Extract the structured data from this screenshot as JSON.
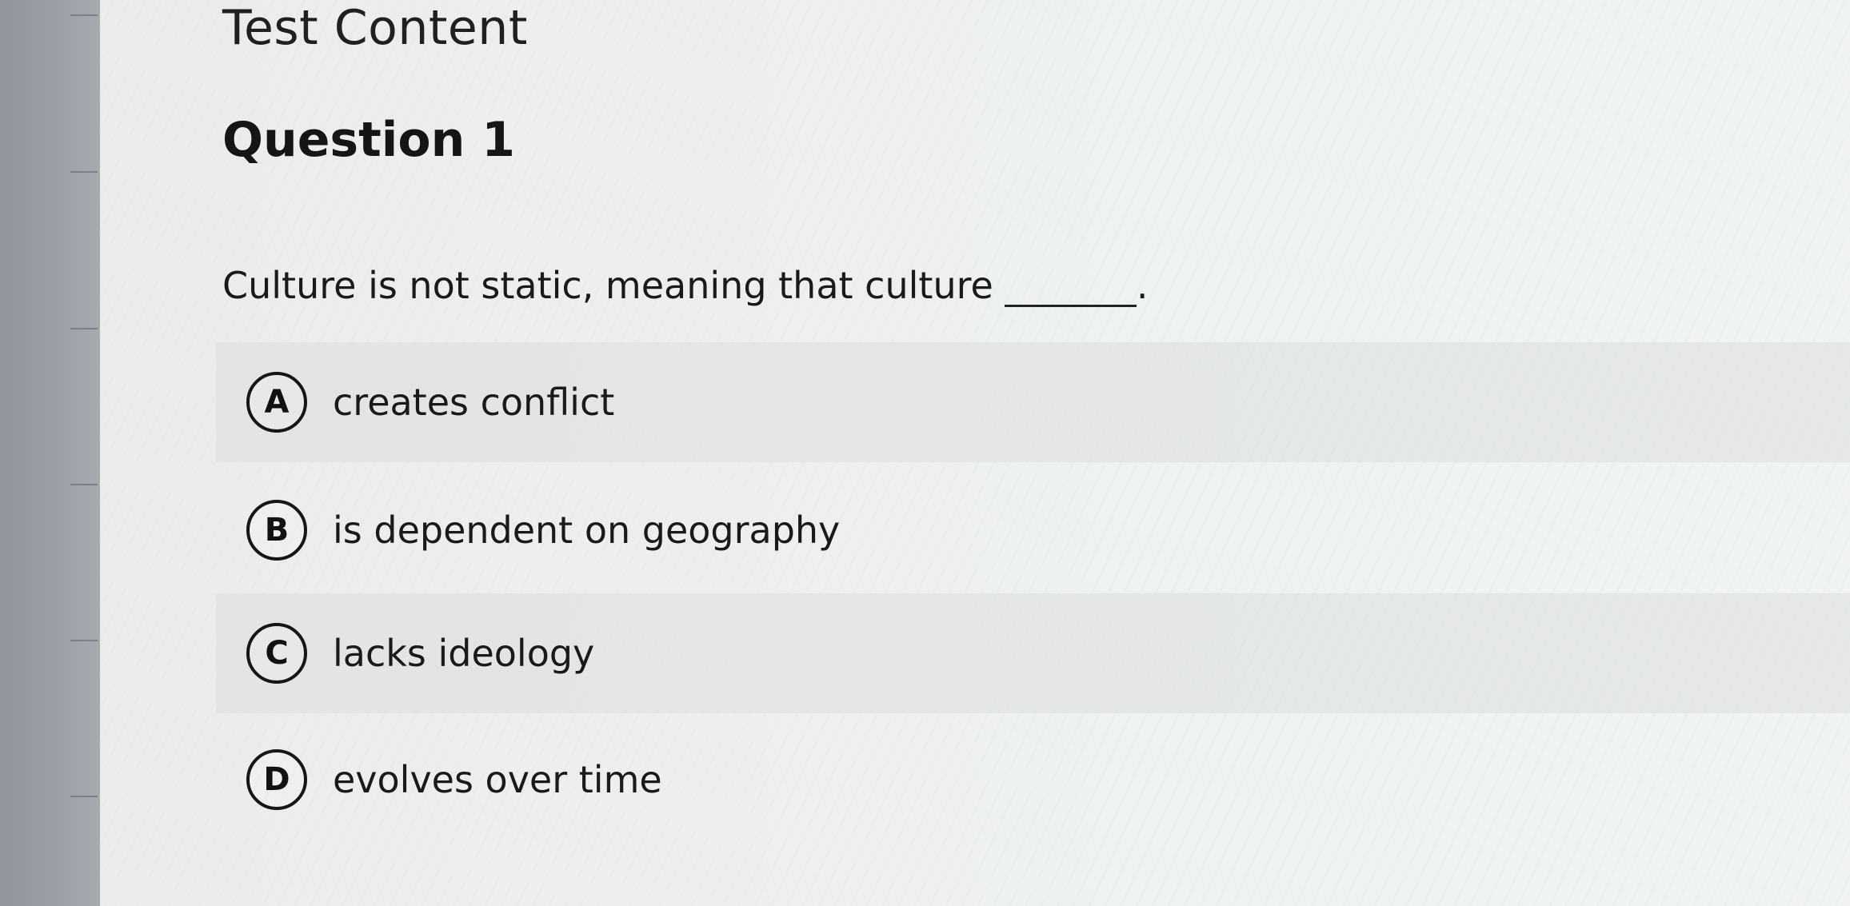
{
  "page": {
    "heading": "Test Content"
  },
  "question": {
    "title": "Question 1",
    "prompt": "Culture is not static, meaning that culture",
    "end_punctuation": ".",
    "choices": [
      {
        "letter": "A",
        "text": "creates conflict"
      },
      {
        "letter": "B",
        "text": "is dependent on geography"
      },
      {
        "letter": "C",
        "text": "lacks ideology"
      },
      {
        "letter": "D",
        "text": "evolves over time"
      }
    ]
  }
}
